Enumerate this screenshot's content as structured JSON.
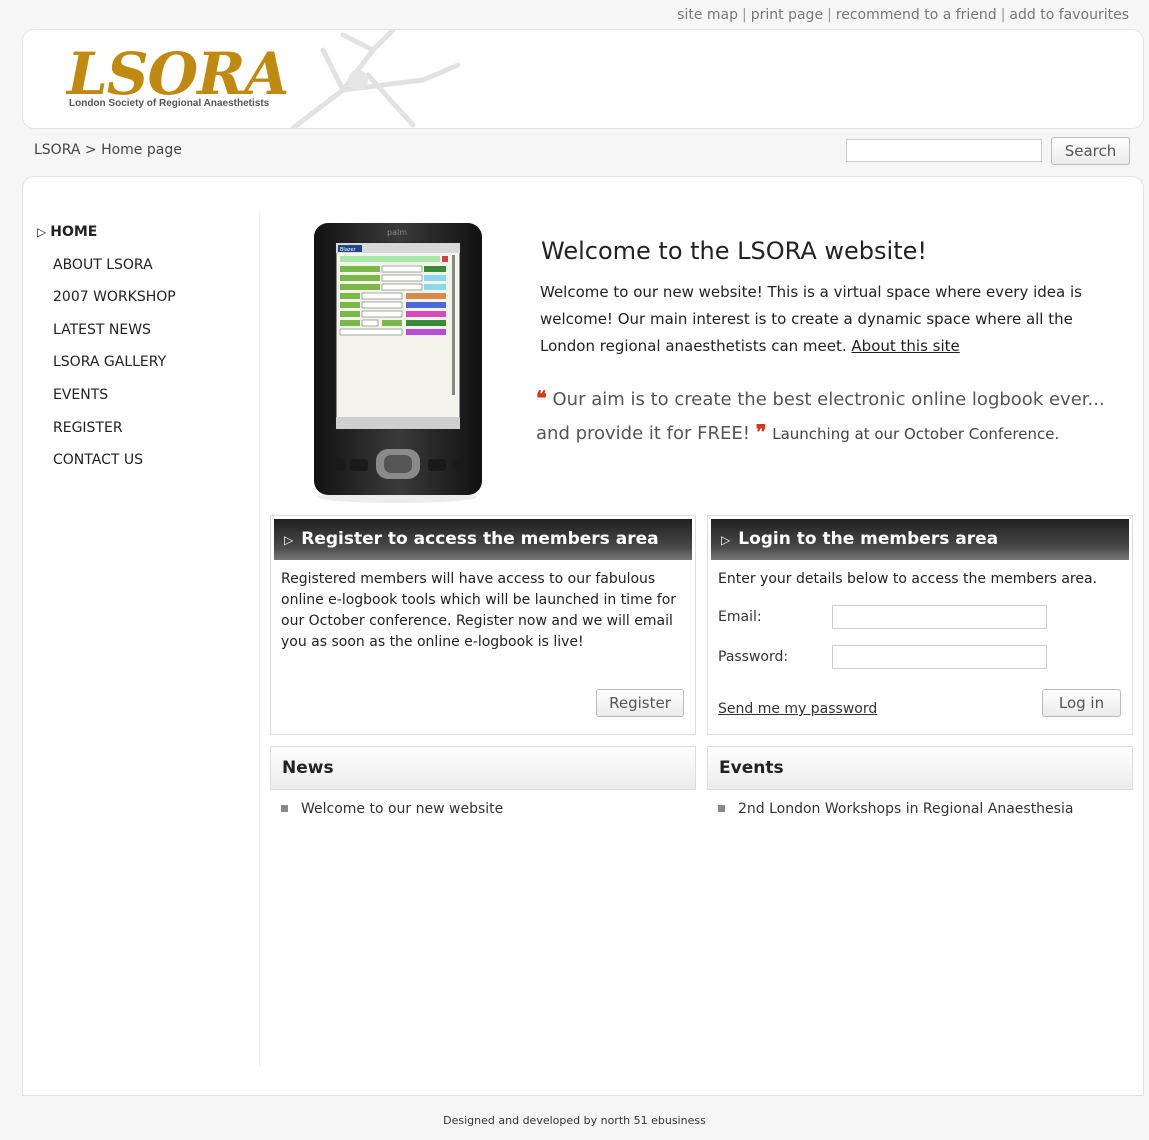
{
  "toplinks": [
    "site map",
    "print page",
    "recommend to a friend",
    "add to favourites"
  ],
  "logo": {
    "word": "LSORA",
    "subtitle": "London Society of Regional Anaesthetists"
  },
  "breadcrumb": "LSORA > Home page",
  "search": {
    "button_label": "Search",
    "value": ""
  },
  "nav": {
    "items": [
      {
        "label": "HOME",
        "active": true
      },
      {
        "label": "ABOUT LSORA"
      },
      {
        "label": "2007 WORKSHOP"
      },
      {
        "label": "LATEST NEWS"
      },
      {
        "label": "LSORA GALLERY"
      },
      {
        "label": "EVENTS"
      },
      {
        "label": "REGISTER"
      },
      {
        "label": "CONTACT US"
      }
    ]
  },
  "welcome": {
    "title": "Welcome to the LSORA website!",
    "text": "Welcome to our new website! This is a virtual space where every idea is welcome! Our main interest is to create a dynamic space where all the London regional anaesthetists can meet.",
    "link": "About this site"
  },
  "quote": {
    "text": "Our aim is to create the best electronic online logbook ever... and provide it for FREE!",
    "after": "Launching at our October Conference."
  },
  "register_panel": {
    "title": "Register to access the members area",
    "text": "Registered members will have access to our fabulous online e-logbook tools which will be launched in time for our October conference. Register now and we will email you as soon as the online e-logbook is live!",
    "button": "Register"
  },
  "login_panel": {
    "title": "Login to the members area",
    "intro": "Enter your details below to access the members area.",
    "email_label": "Email:",
    "password_label": "Password:",
    "forgot_link": "Send me my password",
    "button": "Log in"
  },
  "news": {
    "title": "News",
    "items": [
      "Welcome to our new website"
    ]
  },
  "events": {
    "title": "Events",
    "items": [
      "2nd London Workshops in Regional Anaesthesia"
    ]
  },
  "device": {
    "brand": "palm",
    "app": "Blazer"
  },
  "footer": "Designed and developed by north 51 ebusiness",
  "colors": {
    "logo_gold": "#c08a12",
    "quote_mark": "#d23a1a",
    "panel_header": "#2a2a2a"
  }
}
